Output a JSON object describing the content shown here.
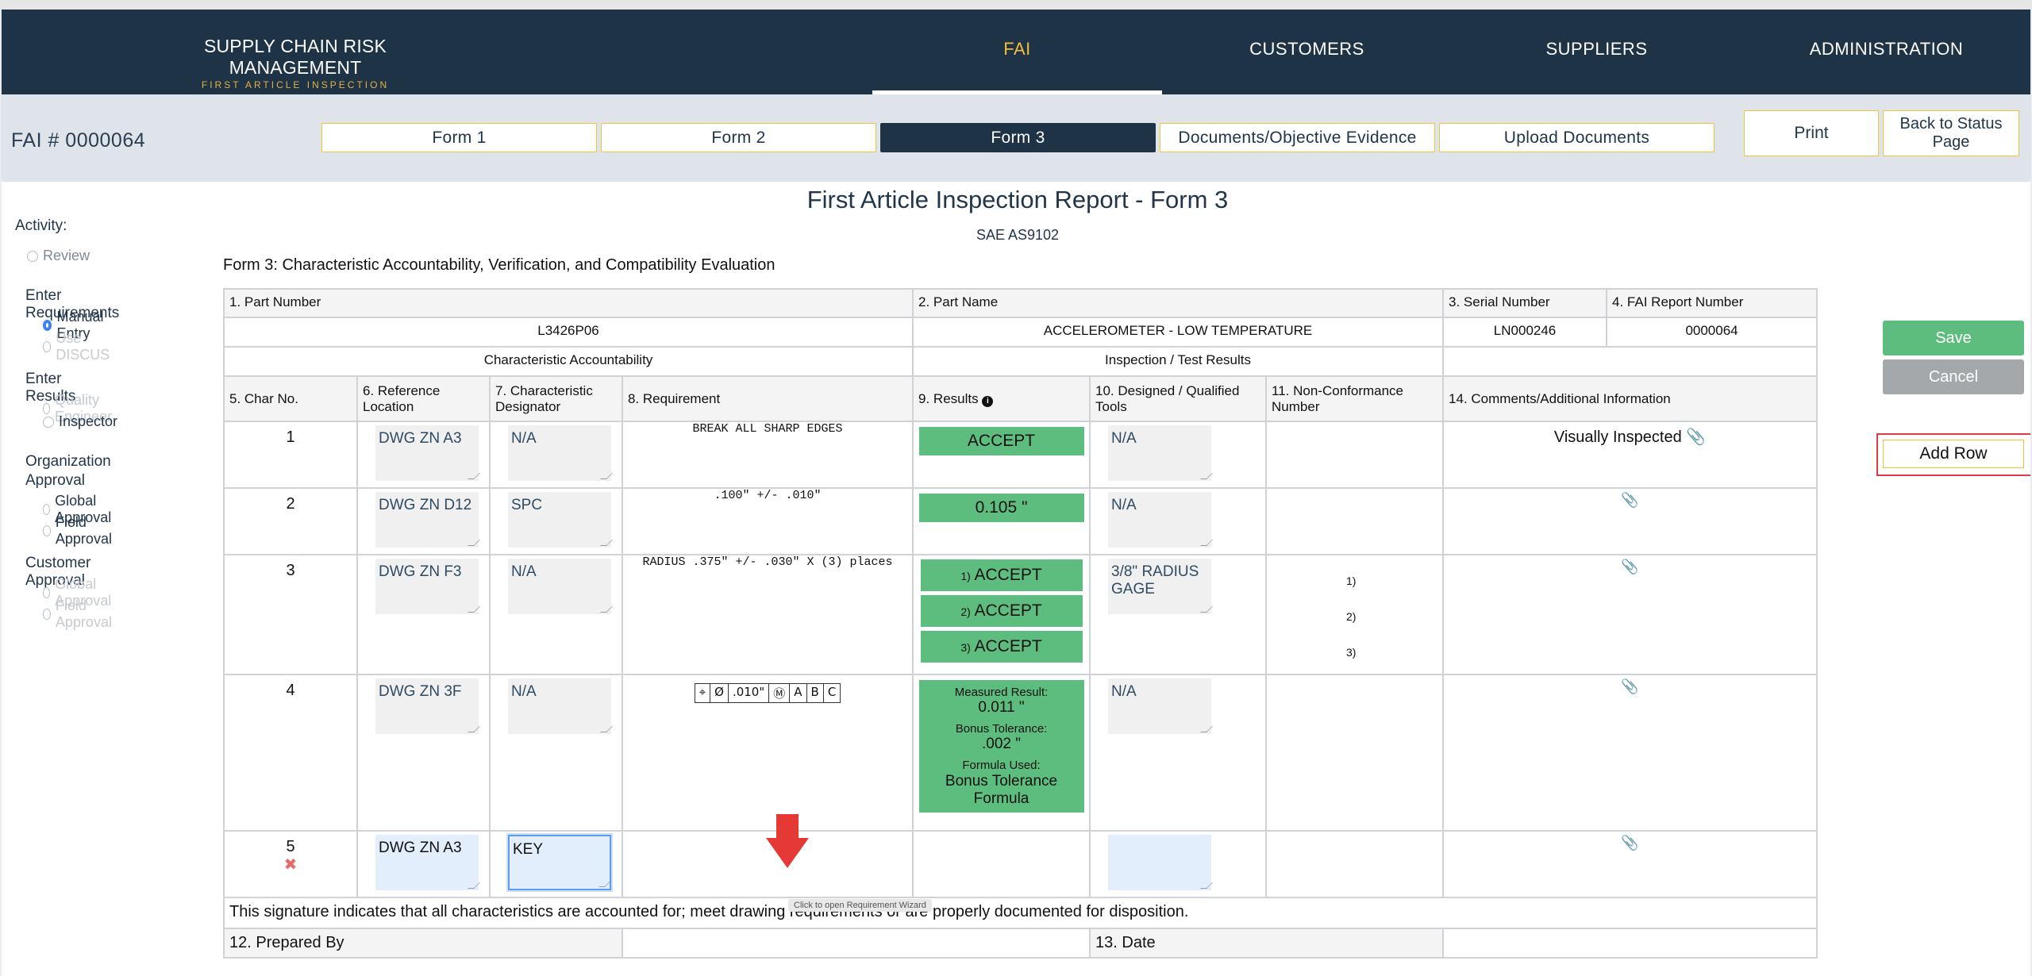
{
  "header": {
    "brand_title": "SUPPLY CHAIN RISK MANAGEMENT",
    "brand_sub": "FIRST ARTICLE INSPECTION",
    "nav": [
      "FAI",
      "CUSTOMERS",
      "SUPPLIERS",
      "ADMINISTRATION"
    ],
    "active_nav": "FAI"
  },
  "subbar": {
    "fai_number": "FAI # 0000064",
    "tabs": [
      "Form 1",
      "Form 2",
      "Form 3",
      "Documents/Objective Evidence",
      "Upload Documents"
    ],
    "active_tab": "Form 3",
    "print": "Print",
    "back": "Back to Status Page"
  },
  "sidebar": {
    "activity": "Activity:",
    "review": "Review",
    "enter_requirements": "Enter Requirements",
    "manual_entry": "Manual Entry",
    "use_discus": "Use DISCUS",
    "enter_results": "Enter Results",
    "quality_engineer": "Quality Engineer",
    "inspector": "Inspector",
    "org_approval": "Organization Approval",
    "global_approval": "Global Approval",
    "field_approval": "Field Approval",
    "customer_approval": "Customer Approval",
    "cust_global_approval": "Global Approval",
    "cust_field_approval": "Field Approval"
  },
  "report": {
    "title": "First Article Inspection Report - Form 3",
    "standard": "SAE AS9102",
    "description": "Form 3: Characteristic Accountability, Verification, and Compatibility Evaluation",
    "labels": {
      "part_number": "1. Part Number",
      "part_name": "2. Part Name",
      "serial_number": "3. Serial Number",
      "fai_report_number": "4. FAI Report Number",
      "char_accountability": "Characteristic Accountability",
      "inspection_results": "Inspection / Test Results",
      "char_no": "5. Char No.",
      "ref_location": "6. Reference Location",
      "char_designator": "7. Characteristic Designator",
      "requirement": "8. Requirement",
      "results": "9. Results",
      "tools": "10. Designed / Qualified Tools",
      "nonconformance": "11. Non-Conformance Number",
      "comments": "14. Comments/Additional Information",
      "signature": "This signature indicates that all characteristics are accounted for; meet drawing requirements or are properly documented for disposition.",
      "prepared_by": "12. Prepared By",
      "date": "13. Date"
    },
    "values": {
      "part_number": "L3426P06",
      "part_name": "ACCELEROMETER - LOW TEMPERATURE",
      "serial_number": "LN000246",
      "fai_report_number": "0000064"
    },
    "rows": [
      {
        "no": "1",
        "ref": "DWG ZN A3",
        "desig": "N/A",
        "req": "BREAK ALL SHARP EDGES",
        "result": "ACCEPT",
        "tools": "N/A",
        "comment": "Visually Inspected"
      },
      {
        "no": "2",
        "ref": "DWG ZN D12",
        "desig": "SPC",
        "req": ".100\" +/- .010\"",
        "result": "0.105 \"",
        "tools": "N/A",
        "comment": ""
      },
      {
        "no": "3",
        "ref": "DWG ZN F3",
        "desig": "N/A",
        "req": "RADIUS .375\" +/- .030\" X (3) places",
        "results": [
          "ACCEPT",
          "ACCEPT",
          "ACCEPT"
        ],
        "result_idx": [
          "1)",
          "2)",
          "3)"
        ],
        "tools": "3/8\" RADIUS GAGE",
        "nc": [
          "1)",
          "2)",
          "3)"
        ]
      },
      {
        "no": "4",
        "ref": "DWG ZN 3F",
        "desig": "N/A",
        "gdt": [
          "⌖",
          "Ø",
          ".010\"",
          "Ⓜ",
          "A",
          "B",
          "C"
        ],
        "measured_label": "Measured Result:",
        "measured": "0.011 \"",
        "bonus_label": "Bonus Tolerance:",
        "bonus": ".002 \"",
        "formula_label": "Formula Used:",
        "formula": "Bonus Tolerance Formula",
        "tools": "N/A"
      },
      {
        "no": "5",
        "ref": "DWG ZN A3",
        "desig": "KEY",
        "tools": ""
      }
    ],
    "tooltip": "Click to open Requirement Wizard"
  },
  "actions": {
    "save": "Save",
    "cancel": "Cancel",
    "add_row": "Add Row"
  },
  "colors": {
    "navy": "#1f3347",
    "gold": "#f0bd3c",
    "green": "#5dbd7e",
    "red": "#e53935"
  }
}
